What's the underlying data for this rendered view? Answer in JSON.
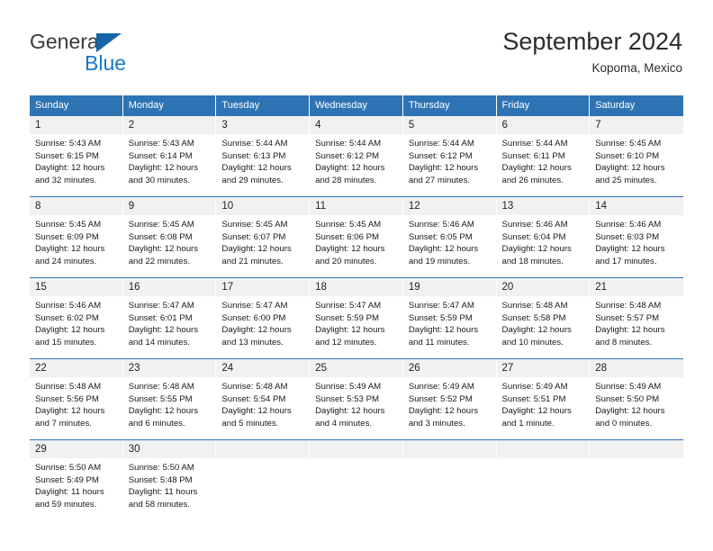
{
  "brand": {
    "name_dark": "General",
    "name_blue": "Blue",
    "triangle_icon": "blue-triangle-icon",
    "accent_color": "#1878c8",
    "triangle_color": "#1565a8"
  },
  "header": {
    "title": "September 2024",
    "subtitle": "Kopoma, Mexico"
  },
  "calendar": {
    "header_bg": "#2e74b5",
    "daynum_bg": "#f1f1f1",
    "weekdays": [
      "Sunday",
      "Monday",
      "Tuesday",
      "Wednesday",
      "Thursday",
      "Friday",
      "Saturday"
    ],
    "weeks": [
      [
        {
          "day": "1",
          "sunrise": "Sunrise: 5:43 AM",
          "sunset": "Sunset: 6:15 PM",
          "daylight1": "Daylight: 12 hours",
          "daylight2": "and 32 minutes."
        },
        {
          "day": "2",
          "sunrise": "Sunrise: 5:43 AM",
          "sunset": "Sunset: 6:14 PM",
          "daylight1": "Daylight: 12 hours",
          "daylight2": "and 30 minutes."
        },
        {
          "day": "3",
          "sunrise": "Sunrise: 5:44 AM",
          "sunset": "Sunset: 6:13 PM",
          "daylight1": "Daylight: 12 hours",
          "daylight2": "and 29 minutes."
        },
        {
          "day": "4",
          "sunrise": "Sunrise: 5:44 AM",
          "sunset": "Sunset: 6:12 PM",
          "daylight1": "Daylight: 12 hours",
          "daylight2": "and 28 minutes."
        },
        {
          "day": "5",
          "sunrise": "Sunrise: 5:44 AM",
          "sunset": "Sunset: 6:12 PM",
          "daylight1": "Daylight: 12 hours",
          "daylight2": "and 27 minutes."
        },
        {
          "day": "6",
          "sunrise": "Sunrise: 5:44 AM",
          "sunset": "Sunset: 6:11 PM",
          "daylight1": "Daylight: 12 hours",
          "daylight2": "and 26 minutes."
        },
        {
          "day": "7",
          "sunrise": "Sunrise: 5:45 AM",
          "sunset": "Sunset: 6:10 PM",
          "daylight1": "Daylight: 12 hours",
          "daylight2": "and 25 minutes."
        }
      ],
      [
        {
          "day": "8",
          "sunrise": "Sunrise: 5:45 AM",
          "sunset": "Sunset: 6:09 PM",
          "daylight1": "Daylight: 12 hours",
          "daylight2": "and 24 minutes."
        },
        {
          "day": "9",
          "sunrise": "Sunrise: 5:45 AM",
          "sunset": "Sunset: 6:08 PM",
          "daylight1": "Daylight: 12 hours",
          "daylight2": "and 22 minutes."
        },
        {
          "day": "10",
          "sunrise": "Sunrise: 5:45 AM",
          "sunset": "Sunset: 6:07 PM",
          "daylight1": "Daylight: 12 hours",
          "daylight2": "and 21 minutes."
        },
        {
          "day": "11",
          "sunrise": "Sunrise: 5:45 AM",
          "sunset": "Sunset: 6:06 PM",
          "daylight1": "Daylight: 12 hours",
          "daylight2": "and 20 minutes."
        },
        {
          "day": "12",
          "sunrise": "Sunrise: 5:46 AM",
          "sunset": "Sunset: 6:05 PM",
          "daylight1": "Daylight: 12 hours",
          "daylight2": "and 19 minutes."
        },
        {
          "day": "13",
          "sunrise": "Sunrise: 5:46 AM",
          "sunset": "Sunset: 6:04 PM",
          "daylight1": "Daylight: 12 hours",
          "daylight2": "and 18 minutes."
        },
        {
          "day": "14",
          "sunrise": "Sunrise: 5:46 AM",
          "sunset": "Sunset: 6:03 PM",
          "daylight1": "Daylight: 12 hours",
          "daylight2": "and 17 minutes."
        }
      ],
      [
        {
          "day": "15",
          "sunrise": "Sunrise: 5:46 AM",
          "sunset": "Sunset: 6:02 PM",
          "daylight1": "Daylight: 12 hours",
          "daylight2": "and 15 minutes."
        },
        {
          "day": "16",
          "sunrise": "Sunrise: 5:47 AM",
          "sunset": "Sunset: 6:01 PM",
          "daylight1": "Daylight: 12 hours",
          "daylight2": "and 14 minutes."
        },
        {
          "day": "17",
          "sunrise": "Sunrise: 5:47 AM",
          "sunset": "Sunset: 6:00 PM",
          "daylight1": "Daylight: 12 hours",
          "daylight2": "and 13 minutes."
        },
        {
          "day": "18",
          "sunrise": "Sunrise: 5:47 AM",
          "sunset": "Sunset: 5:59 PM",
          "daylight1": "Daylight: 12 hours",
          "daylight2": "and 12 minutes."
        },
        {
          "day": "19",
          "sunrise": "Sunrise: 5:47 AM",
          "sunset": "Sunset: 5:59 PM",
          "daylight1": "Daylight: 12 hours",
          "daylight2": "and 11 minutes."
        },
        {
          "day": "20",
          "sunrise": "Sunrise: 5:48 AM",
          "sunset": "Sunset: 5:58 PM",
          "daylight1": "Daylight: 12 hours",
          "daylight2": "and 10 minutes."
        },
        {
          "day": "21",
          "sunrise": "Sunrise: 5:48 AM",
          "sunset": "Sunset: 5:57 PM",
          "daylight1": "Daylight: 12 hours",
          "daylight2": "and 8 minutes."
        }
      ],
      [
        {
          "day": "22",
          "sunrise": "Sunrise: 5:48 AM",
          "sunset": "Sunset: 5:56 PM",
          "daylight1": "Daylight: 12 hours",
          "daylight2": "and 7 minutes."
        },
        {
          "day": "23",
          "sunrise": "Sunrise: 5:48 AM",
          "sunset": "Sunset: 5:55 PM",
          "daylight1": "Daylight: 12 hours",
          "daylight2": "and 6 minutes."
        },
        {
          "day": "24",
          "sunrise": "Sunrise: 5:48 AM",
          "sunset": "Sunset: 5:54 PM",
          "daylight1": "Daylight: 12 hours",
          "daylight2": "and 5 minutes."
        },
        {
          "day": "25",
          "sunrise": "Sunrise: 5:49 AM",
          "sunset": "Sunset: 5:53 PM",
          "daylight1": "Daylight: 12 hours",
          "daylight2": "and 4 minutes."
        },
        {
          "day": "26",
          "sunrise": "Sunrise: 5:49 AM",
          "sunset": "Sunset: 5:52 PM",
          "daylight1": "Daylight: 12 hours",
          "daylight2": "and 3 minutes."
        },
        {
          "day": "27",
          "sunrise": "Sunrise: 5:49 AM",
          "sunset": "Sunset: 5:51 PM",
          "daylight1": "Daylight: 12 hours",
          "daylight2": "and 1 minute."
        },
        {
          "day": "28",
          "sunrise": "Sunrise: 5:49 AM",
          "sunset": "Sunset: 5:50 PM",
          "daylight1": "Daylight: 12 hours",
          "daylight2": "and 0 minutes."
        }
      ],
      [
        {
          "day": "29",
          "sunrise": "Sunrise: 5:50 AM",
          "sunset": "Sunset: 5:49 PM",
          "daylight1": "Daylight: 11 hours",
          "daylight2": "and 59 minutes."
        },
        {
          "day": "30",
          "sunrise": "Sunrise: 5:50 AM",
          "sunset": "Sunset: 5:48 PM",
          "daylight1": "Daylight: 11 hours",
          "daylight2": "and 58 minutes."
        },
        {
          "day": "",
          "sunrise": "",
          "sunset": "",
          "daylight1": "",
          "daylight2": ""
        },
        {
          "day": "",
          "sunrise": "",
          "sunset": "",
          "daylight1": "",
          "daylight2": ""
        },
        {
          "day": "",
          "sunrise": "",
          "sunset": "",
          "daylight1": "",
          "daylight2": ""
        },
        {
          "day": "",
          "sunrise": "",
          "sunset": "",
          "daylight1": "",
          "daylight2": ""
        },
        {
          "day": "",
          "sunrise": "",
          "sunset": "",
          "daylight1": "",
          "daylight2": ""
        }
      ]
    ]
  }
}
